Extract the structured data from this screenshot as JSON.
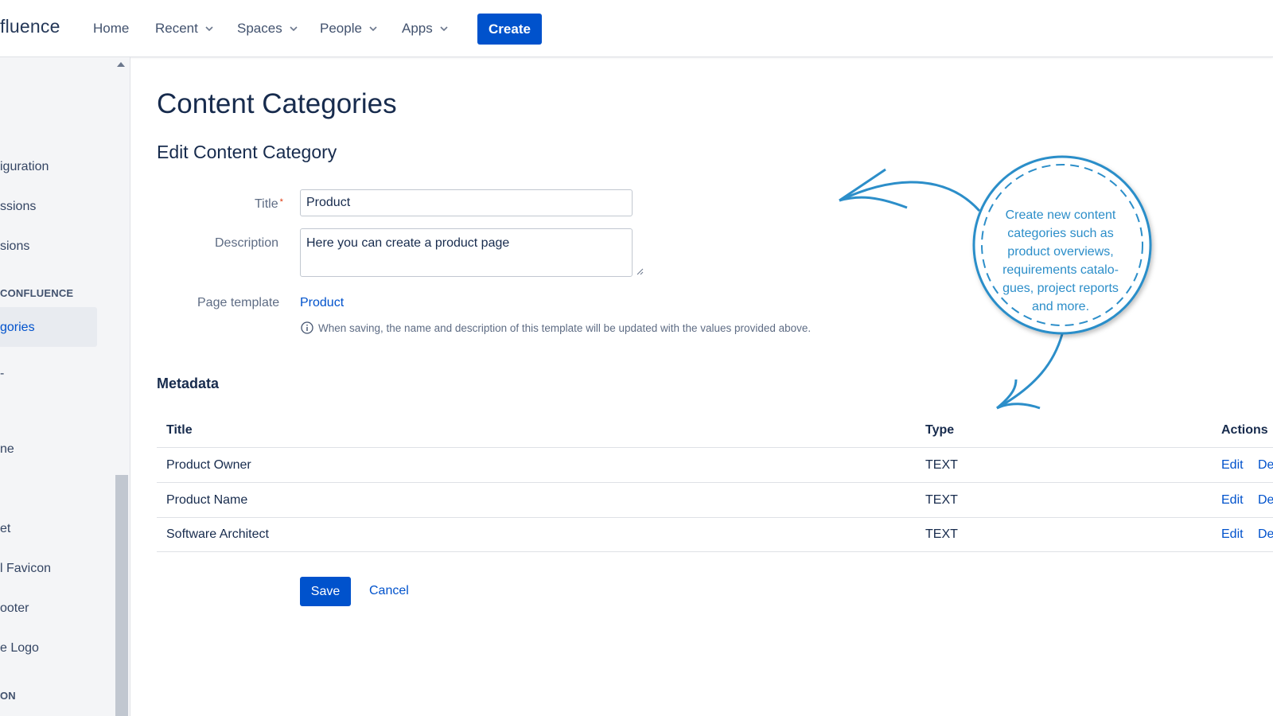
{
  "topbar": {
    "logo": "fluence",
    "nav": [
      {
        "label": "Home",
        "dropdown": false
      },
      {
        "label": "Recent",
        "dropdown": true
      },
      {
        "label": "Spaces",
        "dropdown": true
      },
      {
        "label": "People",
        "dropdown": true
      },
      {
        "label": "Apps",
        "dropdown": true
      }
    ],
    "create_label": "Create"
  },
  "sidebar": {
    "items": [
      "iguration",
      "ssions",
      "sions",
      "gories",
      "ne",
      "et",
      "l Favicon",
      "ooter",
      "e Logo"
    ],
    "heading_confluence": "CONFLUENCE",
    "heading_on": "ON",
    "dash": "-"
  },
  "main": {
    "title": "Content Categories",
    "subtitle": "Edit Content Category",
    "form": {
      "title_label": "Title",
      "required_mark": "*",
      "title_value": "Product",
      "description_label": "Description",
      "description_value": "Here you can create a product page",
      "template_label": "Page template",
      "template_value": "Product",
      "hint": "When saving, the name and description of this template will be updated with the values provided above."
    },
    "metadata": {
      "title": "Metadata",
      "columns": [
        "Title",
        "Type",
        "Actions"
      ],
      "rows": [
        {
          "title": "Product Owner",
          "type": "TEXT",
          "edit": "Edit",
          "delete": "De"
        },
        {
          "title": "Product Name",
          "type": "TEXT",
          "edit": "Edit",
          "delete": "De"
        },
        {
          "title": "Software Architect",
          "type": "TEXT",
          "edit": "Edit",
          "delete": "De"
        }
      ]
    },
    "save_label": "Save",
    "cancel_label": "Cancel"
  },
  "annotation": {
    "lines": [
      "Create new content",
      "categories such as",
      "product overviews,",
      "requirements catalo-",
      "gues, project reports",
      "and more."
    ]
  },
  "colors": {
    "primary": "#0052cc",
    "annotation": "#2c8ec9",
    "text": "#172b4d"
  }
}
